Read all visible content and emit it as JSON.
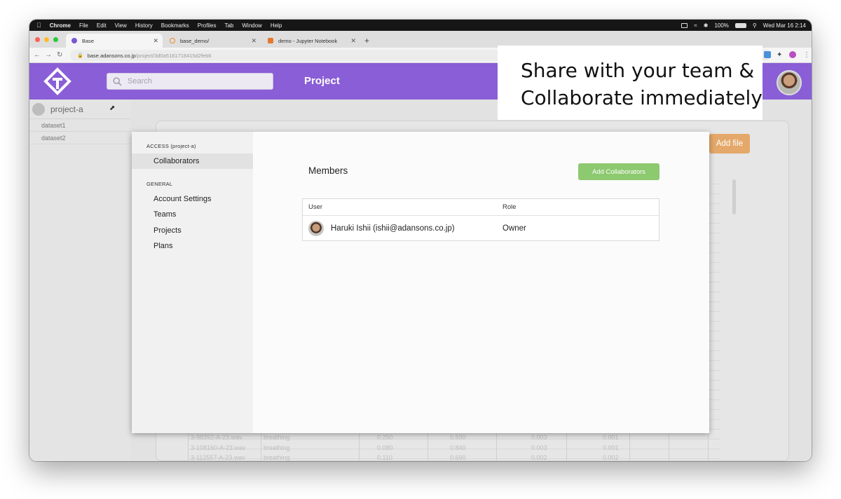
{
  "menubar": {
    "app": "Chrome",
    "items": [
      "File",
      "Edit",
      "View",
      "History",
      "Bookmarks",
      "Profiles",
      "Tab",
      "Window",
      "Help"
    ],
    "battery": "100%",
    "clock": "Wed Mar 16  2:14"
  },
  "tabs": [
    {
      "title": "Base",
      "favicon_color": "#7b57d1",
      "active": true
    },
    {
      "title": "base_demo/",
      "favicon_color": "#f08a2b",
      "active": false
    },
    {
      "title": "demo - Jupyter Notebook",
      "favicon_color": "#e8772e",
      "active": false
    }
  ],
  "address": {
    "host": "base.adansons.co.jp",
    "path": "/project/3d0a5161718415d2feb6"
  },
  "header": {
    "search_placeholder": "Search",
    "title": "Project"
  },
  "project_sidebar": {
    "project_name": "project-a",
    "datasets": [
      "dataset1",
      "dataset2"
    ]
  },
  "background": {
    "add_file_label": "Add file",
    "rows": [
      {
        "file": "3-98392-A-23.wav",
        "label": "breathing",
        "v1": "0.250",
        "v2": "0.500",
        "v3": "0.003",
        "v4": "0.001"
      },
      {
        "file": "3-108160-A-23.wav",
        "label": "breathing",
        "v1": "0.080",
        "v2": "0.840",
        "v3": "0.003",
        "v4": "0.001"
      },
      {
        "file": "3-112557-A-23.wav",
        "label": "breathing",
        "v1": "0.110",
        "v2": "0.690",
        "v3": "0.002",
        "v4": "0.002"
      }
    ]
  },
  "modal": {
    "access_section": "ACCESS (project-a)",
    "access_items": [
      "Collaborators"
    ],
    "general_section": "GENERAL",
    "general_items": [
      "Account Settings",
      "Teams",
      "Projects",
      "Plans"
    ],
    "members_title": "Members",
    "add_button": "Add Collaborators",
    "table": {
      "headers": [
        "User",
        "Role"
      ],
      "rows": [
        {
          "user": "Haruki Ishii (ishii@adansons.co.jp)",
          "role": "Owner"
        }
      ]
    }
  },
  "caption": {
    "line1": "Share with your team &",
    "line2": "Collaborate immediately"
  },
  "colors": {
    "brand_purple": "#8a5ed6",
    "add_button_green": "#8dc96f",
    "add_file_orange": "#e4a86a"
  }
}
